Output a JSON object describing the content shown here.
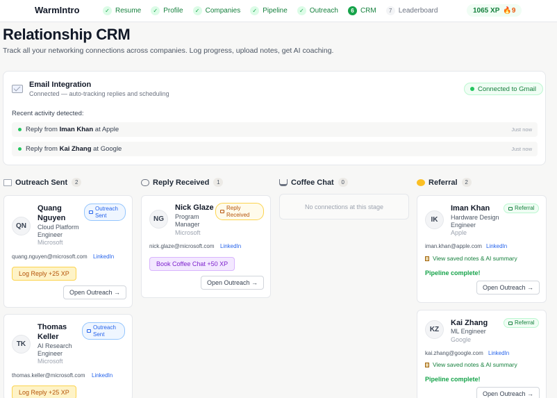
{
  "app": {
    "name": "WarmIntro"
  },
  "nav": [
    {
      "label": "Resume",
      "mark": "✓",
      "state": "done"
    },
    {
      "label": "Profile",
      "mark": "✓",
      "state": "done"
    },
    {
      "label": "Companies",
      "mark": "✓",
      "state": "done"
    },
    {
      "label": "Pipeline",
      "mark": "✓",
      "state": "done"
    },
    {
      "label": "Outreach",
      "mark": "✓",
      "state": "done"
    },
    {
      "label": "CRM",
      "mark": "6",
      "state": "active"
    },
    {
      "label": "Leaderboard",
      "mark": "7",
      "state": "locked"
    }
  ],
  "xp": {
    "label": "1065 XP",
    "streak": "🔥9"
  },
  "header": {
    "title": "Relationship CRM",
    "subtitle": "Track all your networking connections across companies. Log progress, upload notes, get AI coaching."
  },
  "email": {
    "title": "Email Integration",
    "status": "Connected — auto-tracking replies and scheduling",
    "connected_label": "Connected to Gmail",
    "recent_label": "Recent activity detected:",
    "activity": [
      {
        "prefix": "Reply from ",
        "name": "Iman Khan",
        "mid": " at ",
        "company": "Apple",
        "time": "Just now"
      },
      {
        "prefix": "Reply from ",
        "name": "Kai Zhang",
        "mid": " at ",
        "company": "Google",
        "time": "Just now"
      }
    ]
  },
  "columns": {
    "outreach": {
      "title": "Outreach Sent",
      "count": "2"
    },
    "reply": {
      "title": "Reply Received",
      "count": "1"
    },
    "coffee": {
      "title": "Coffee Chat",
      "count": "0",
      "empty": "No connections at this stage"
    },
    "referral": {
      "title": "Referral",
      "count": "2"
    }
  },
  "cards": {
    "quang": {
      "initials": "QN",
      "name": "Quang Nguyen",
      "role": "Cloud Platform Engineer",
      "company": "Microsoft",
      "badge": "Outreach Sent",
      "email": "quang.nguyen@microsoft.com",
      "link": "LinkedIn",
      "action": "Log Reply +25 XP",
      "open": "Open Outreach →"
    },
    "thomas": {
      "initials": "TK",
      "name": "Thomas Keller",
      "role": "AI Research Engineer",
      "company": "Microsoft",
      "badge": "Outreach Sent",
      "email": "thomas.keller@microsoft.com",
      "link": "LinkedIn",
      "action": "Log Reply +25 XP"
    },
    "nick": {
      "initials": "NG",
      "name": "Nick Glaze",
      "role": "Program Manager",
      "company": "Microsoft",
      "badge": "Reply Received",
      "email": "nick.glaze@microsoft.com",
      "link": "LinkedIn",
      "action": "Book Coffee Chat +50 XP",
      "open": "Open Outreach →"
    },
    "iman": {
      "initials": "IK",
      "name": "Iman Khan",
      "role": "Hardware Design Engineer",
      "company": "Apple",
      "badge": "Referral",
      "email": "iman.khan@apple.com",
      "link": "LinkedIn",
      "notes": "View saved notes & AI summary",
      "complete": "Pipeline complete!",
      "open": "Open Outreach →"
    },
    "kai": {
      "initials": "KZ",
      "name": "Kai Zhang",
      "role": "ML Engineer",
      "company": "Google",
      "badge": "Referral",
      "email": "kai.zhang@google.com",
      "link": "LinkedIn",
      "notes": "View saved notes & AI summary",
      "complete": "Pipeline complete!",
      "open": "Open Outreach →"
    }
  }
}
